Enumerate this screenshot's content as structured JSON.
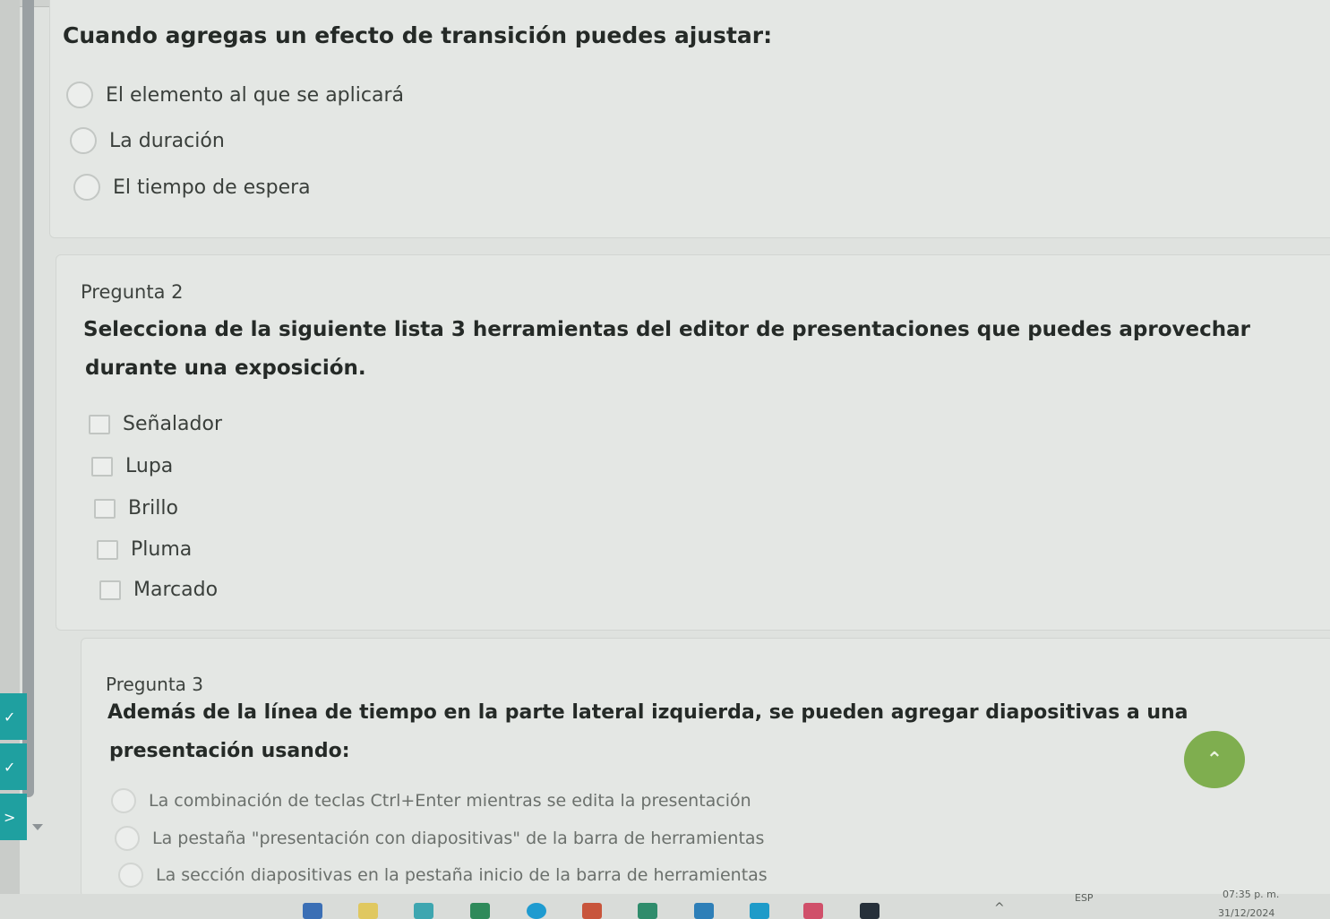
{
  "question1": {
    "title": "Cuando agregas un efecto de transición puedes ajustar:",
    "options": [
      "El elemento al que se aplicará",
      "La duración",
      "El tiempo de espera"
    ]
  },
  "question2": {
    "label": "Pregunta 2",
    "title_line1": "Selecciona de la siguiente lista 3 herramientas del editor de presentaciones que puedes aprovechar",
    "title_line2": "durante una exposición.",
    "options": [
      "Señalador",
      "Lupa",
      "Brillo",
      "Pluma",
      "Marcado"
    ]
  },
  "question3": {
    "label": "Pregunta 3",
    "title_line1": "Además de la línea de tiempo en la parte lateral izquierda, se pueden agregar diapositivas a una",
    "title_line2": "presentación usando:",
    "options": [
      "La combinación de teclas Ctrl+Enter mientras se edita la presentación",
      "La pestaña \"presentación con diapositivas\" de la barra de herramientas",
      "La sección diapositivas en la pestaña inicio de la barra de herramientas"
    ]
  },
  "nav": {
    "check1": "✓",
    "check2": "✓",
    "next": ">"
  },
  "scroll_top_icon": "⌃",
  "taskbar": {
    "language": "ESP",
    "time": "07:35 p. m.",
    "date": "31/12/2024",
    "chevron": "^"
  },
  "colors": {
    "accent_teal": "#1fa0a0",
    "scroll_top_green": "#7fae4f"
  }
}
